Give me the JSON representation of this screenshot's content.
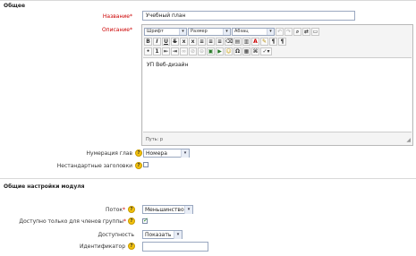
{
  "section_general": {
    "legend": "Общее"
  },
  "fields": {
    "name": {
      "label": "Название",
      "value": "Учебный план"
    },
    "description": {
      "label": "Описание"
    }
  },
  "editor": {
    "font_select": "Шрифт",
    "size_select": "Размер",
    "format_select": "Абзац",
    "content": "УП Веб-дизайн",
    "path_label": "Путь: p"
  },
  "numbering": {
    "label": "Нумерация глав",
    "value": "Номера"
  },
  "custom_titles": {
    "label": "Нестандартные заголовки"
  },
  "section_common": {
    "legend": "Общие настройки модуля"
  },
  "group_mode": {
    "label": "Поток",
    "value": "Меньшинство"
  },
  "members_only": {
    "label": "Доступно только для членов группы"
  },
  "visible": {
    "label": "Доступность",
    "value": "Показать"
  },
  "id_number": {
    "label": "Идентификатор",
    "value": ""
  }
}
